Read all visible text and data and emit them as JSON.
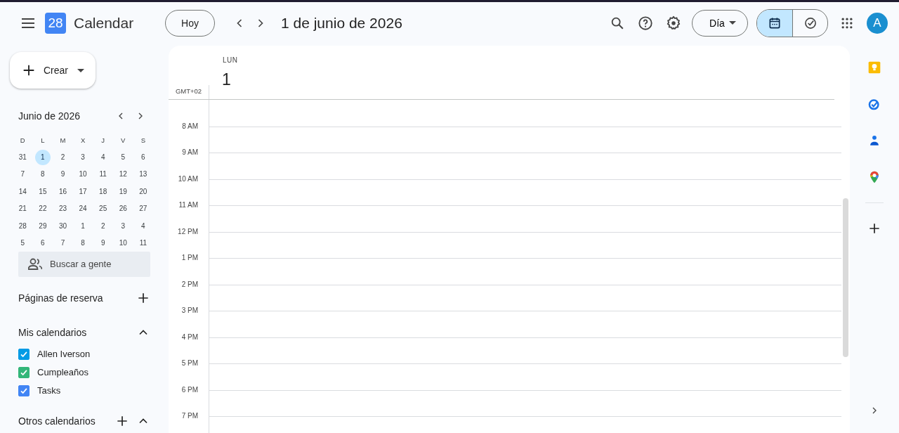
{
  "top_bar": {
    "logo_text": "28",
    "app_name": "Calendar",
    "today_button": "Hoy",
    "date_title": "1 de junio de 2026",
    "view_dropdown": "Día",
    "mode_toggle": [
      {
        "kind": "calendar",
        "selected": true
      },
      {
        "kind": "tasks",
        "selected": false
      }
    ],
    "avatar_letter": "A"
  },
  "sidebar": {
    "create_button": "Crear",
    "mini_calendar": {
      "title": "Junio de 2026",
      "weekdays": [
        "D",
        "L",
        "M",
        "X",
        "J",
        "V",
        "S"
      ],
      "weeks": [
        [
          {
            "day": "31",
            "selected": false
          },
          {
            "day": "1",
            "selected": true
          },
          {
            "day": "2",
            "selected": false
          },
          {
            "day": "3",
            "selected": false
          },
          {
            "day": "4",
            "selected": false
          },
          {
            "day": "5",
            "selected": false
          },
          {
            "day": "6",
            "selected": false
          }
        ],
        [
          {
            "day": "7",
            "selected": false
          },
          {
            "day": "8",
            "selected": false
          },
          {
            "day": "9",
            "selected": false
          },
          {
            "day": "10",
            "selected": false
          },
          {
            "day": "11",
            "selected": false
          },
          {
            "day": "12",
            "selected": false
          },
          {
            "day": "13",
            "selected": false
          }
        ],
        [
          {
            "day": "14",
            "selected": false
          },
          {
            "day": "15",
            "selected": false
          },
          {
            "day": "16",
            "selected": false
          },
          {
            "day": "17",
            "selected": false
          },
          {
            "day": "18",
            "selected": false
          },
          {
            "day": "19",
            "selected": false
          },
          {
            "day": "20",
            "selected": false
          }
        ],
        [
          {
            "day": "21",
            "selected": false
          },
          {
            "day": "22",
            "selected": false
          },
          {
            "day": "23",
            "selected": false
          },
          {
            "day": "24",
            "selected": false
          },
          {
            "day": "25",
            "selected": false
          },
          {
            "day": "26",
            "selected": false
          },
          {
            "day": "27",
            "selected": false
          }
        ],
        [
          {
            "day": "28",
            "selected": false
          },
          {
            "day": "29",
            "selected": false
          },
          {
            "day": "30",
            "selected": false
          },
          {
            "day": "1",
            "selected": false
          },
          {
            "day": "2",
            "selected": false
          },
          {
            "day": "3",
            "selected": false
          },
          {
            "day": "4",
            "selected": false
          }
        ],
        [
          {
            "day": "5",
            "selected": false
          },
          {
            "day": "6",
            "selected": false
          },
          {
            "day": "7",
            "selected": false
          },
          {
            "day": "8",
            "selected": false
          },
          {
            "day": "9",
            "selected": false
          },
          {
            "day": "10",
            "selected": false
          },
          {
            "day": "11",
            "selected": false
          }
        ]
      ]
    },
    "people_search": {
      "placeholder": "Buscar a gente"
    },
    "booking_pages": "Páginas de reserva",
    "my_calendars": {
      "title": "Mis calendarios",
      "expanded": true,
      "items": [
        {
          "name": "Allen Iverson",
          "checked": true,
          "color": "#039be5"
        },
        {
          "name": "Cumpleaños",
          "checked": true,
          "color": "#33b679"
        },
        {
          "name": "Tasks",
          "checked": true,
          "color": "#4285f4"
        }
      ]
    },
    "other_calendars": {
      "title": "Otros calendarios",
      "expanded": true
    }
  },
  "day_view": {
    "weekday": "LUN",
    "day": "1",
    "timezone": "GMT+02",
    "hours": [
      "8 AM",
      "9 AM",
      "10 AM",
      "11 AM",
      "12 PM",
      "1 PM",
      "2 PM",
      "3 PM",
      "4 PM",
      "5 PM",
      "6 PM",
      "7 PM"
    ]
  }
}
